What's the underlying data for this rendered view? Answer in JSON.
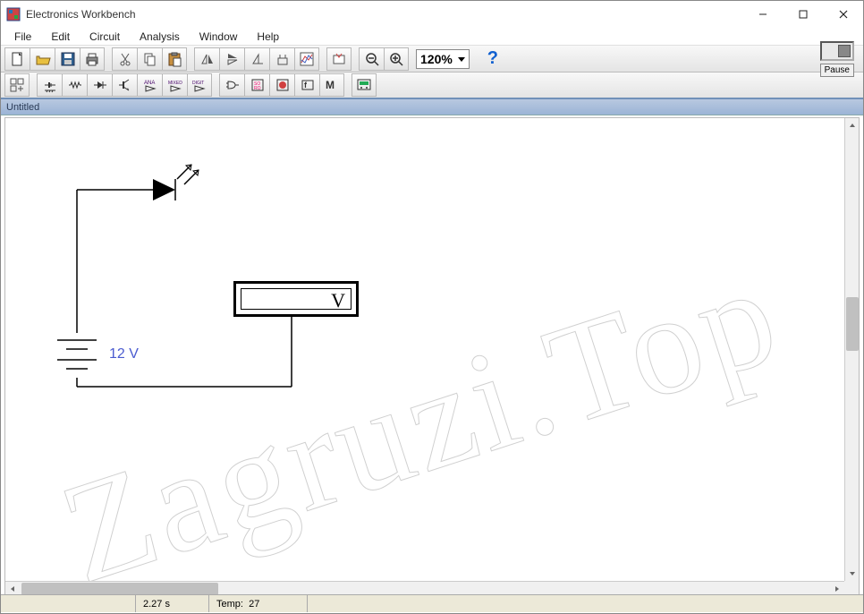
{
  "window": {
    "title": "Electronics Workbench"
  },
  "menubar": {
    "items": [
      "File",
      "Edit",
      "Circuit",
      "Analysis",
      "Window",
      "Help"
    ]
  },
  "toolbar": {
    "zoom_value": "120%",
    "help_label": "?",
    "pause_label": "Pause"
  },
  "document": {
    "title": "Untitled"
  },
  "circuit": {
    "source_label": "12 V",
    "voltmeter_label": "V"
  },
  "statusbar": {
    "time": "2.27 s",
    "temp_label": "Temp:",
    "temp_value": "27"
  },
  "watermark": "Zagruzi.Top"
}
